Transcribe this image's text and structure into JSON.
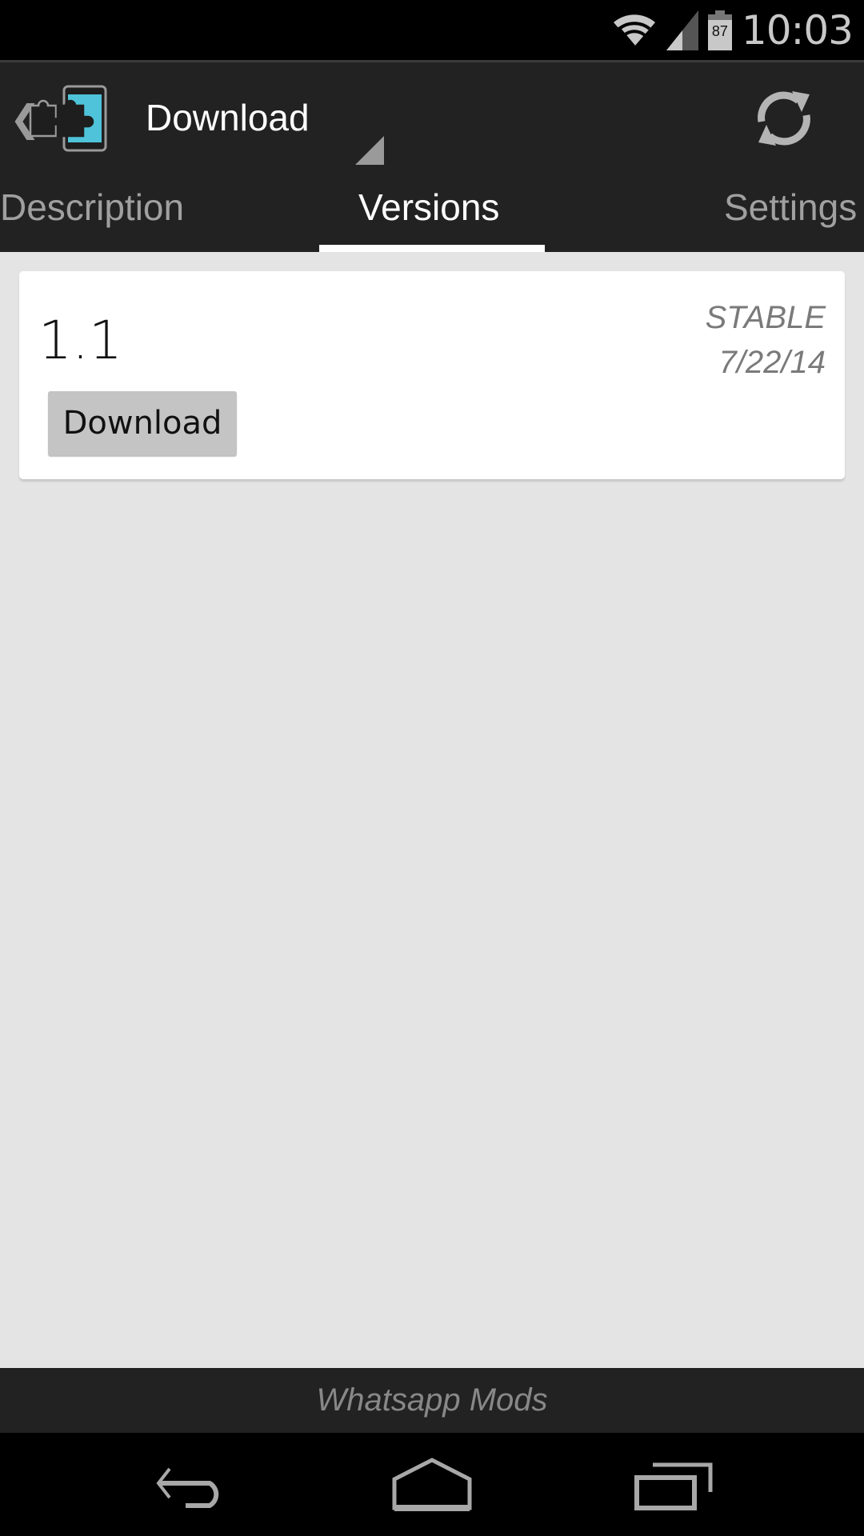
{
  "status_bar": {
    "time": "10:03",
    "battery_level": "87",
    "icons": [
      "wifi-icon",
      "cell-signal-icon",
      "battery-icon"
    ]
  },
  "action_bar": {
    "title": "Download",
    "back_icon": "chevron-left-icon",
    "app_icon": "xposed-puzzle-phone-icon",
    "spinner_icon": "dropdown-triangle-icon",
    "refresh_icon": "refresh-icon"
  },
  "tabs": [
    {
      "label": "Description",
      "active": false
    },
    {
      "label": "Versions",
      "active": true
    },
    {
      "label": "Settings",
      "active": false
    }
  ],
  "versions": [
    {
      "version": "1.1",
      "channel": "STABLE",
      "date": "7/22/14",
      "button_label": "Download"
    }
  ],
  "footer": {
    "text": "Whatsapp Mods"
  },
  "nav_bar": {
    "buttons": [
      "back-icon",
      "home-icon",
      "recents-icon"
    ]
  },
  "colors": {
    "accent_cyan": "#4fc3d9",
    "bar_dark": "#222222",
    "background": "#e4e4e4"
  }
}
